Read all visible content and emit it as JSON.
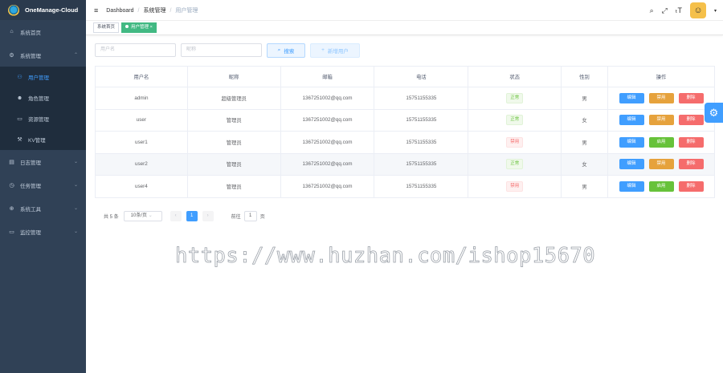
{
  "app": {
    "title": "OneManage-Cloud"
  },
  "sidebar": {
    "items": [
      {
        "label": "系统首页",
        "icon": "dashboard-icon",
        "glyph": "⌂"
      },
      {
        "label": "系统管理",
        "icon": "gear-icon",
        "glyph": "⚙",
        "arrow": "⌃"
      }
    ],
    "sub_items": [
      {
        "label": "用户管理",
        "icon": "user-outline-icon",
        "glyph": "👤"
      },
      {
        "label": "角色管理",
        "icon": "role-icon",
        "glyph": "●"
      },
      {
        "label": "资源管理",
        "icon": "resource-icon",
        "glyph": "▭"
      },
      {
        "label": "KV管理",
        "icon": "kv-icon",
        "glyph": "⚒"
      }
    ],
    "more_items": [
      {
        "label": "日志管理",
        "icon": "log-icon",
        "glyph": "▤",
        "arrow": "⌄"
      },
      {
        "label": "任务管理",
        "icon": "task-icon",
        "glyph": "◷",
        "arrow": "⌄"
      },
      {
        "label": "系统工具",
        "icon": "tool-icon",
        "glyph": "⊕",
        "arrow": "⌄"
      },
      {
        "label": "监控管理",
        "icon": "monitor-icon",
        "glyph": "▭",
        "arrow": "⌄"
      }
    ]
  },
  "header": {
    "breadcrumb": [
      "Dashboard",
      "系统管理",
      "用户管理"
    ],
    "hamburger_icon": "≡",
    "search_icon": "⌕",
    "fullscreen_icon": "⤢",
    "fontsize_icon": "ₜT"
  },
  "tags": [
    {
      "label": "系统首页",
      "active": false
    },
    {
      "label": "用户管理",
      "active": true,
      "close": "×"
    }
  ],
  "filters": {
    "username_placeholder": "用户名",
    "nickname_placeholder": "昵称",
    "search_label": "搜索",
    "add_label": "新增用户",
    "search_icon": "⌕",
    "add_icon": "+"
  },
  "table": {
    "columns": [
      "用户名",
      "昵称",
      "邮箱",
      "电话",
      "状态",
      "性别",
      "操作"
    ],
    "rows": [
      {
        "username": "admin",
        "nickname": "超级管理员",
        "email": "1367251002@qq.com",
        "phone": "15751155335",
        "status": "正常",
        "gender": "男",
        "toggle": "禁用"
      },
      {
        "username": "user",
        "nickname": "管理员",
        "email": "1367251002@qq.com",
        "phone": "15751155335",
        "status": "正常",
        "gender": "女",
        "toggle": "禁用"
      },
      {
        "username": "user1",
        "nickname": "管理员",
        "email": "1367251002@qq.com",
        "phone": "15751155335",
        "status": "禁用",
        "gender": "男",
        "toggle": "启用"
      },
      {
        "username": "user2",
        "nickname": "管理员",
        "email": "1367251002@qq.com",
        "phone": "15751155335",
        "status": "正常",
        "gender": "女",
        "toggle": "禁用"
      },
      {
        "username": "user4",
        "nickname": "管理员",
        "email": "1367251002@qq.com",
        "phone": "15751155335",
        "status": "禁用",
        "gender": "男",
        "toggle": "启用"
      }
    ],
    "edit_label": "编辑",
    "delete_label": "删除"
  },
  "pagination": {
    "total_text": "共 5 条",
    "page_size": "10条/页",
    "current_page": "1",
    "goto_label": "前往",
    "goto_value": "1",
    "page_suffix": "页",
    "prev": "‹",
    "next": "›"
  },
  "watermark": "https://www.huzhan.com/ishop15670",
  "colors": {
    "sidebar": "#304156",
    "primary": "#409eff",
    "success": "#67c23a",
    "warning": "#e6a23c",
    "danger": "#f56c6c",
    "tag_active": "#42b983"
  }
}
